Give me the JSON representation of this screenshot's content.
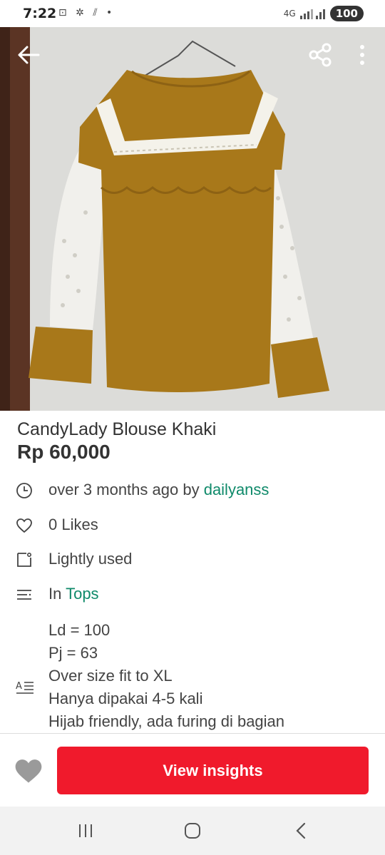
{
  "status_bar": {
    "time": "7:22",
    "icons": "⊡ ✲ ⫽ •",
    "network": "4G",
    "battery": "100"
  },
  "listing": {
    "title": "CandyLady Blouse Khaki",
    "price": "Rp 60,000",
    "posted_prefix": "over 3 months ago by",
    "seller": "dailyanss",
    "likes": "0 Likes",
    "condition": "Lightly used",
    "category_prefix": "In",
    "category": "Tops",
    "description_lines": [
      "Ld = 100",
      "Pj = 63",
      "Over size fit to XL",
      "Hanya dipakai 4-5 kali",
      "Hijab friendly, ada furing di bagian"
    ]
  },
  "actions": {
    "view_insights": "View insights"
  },
  "icons": {
    "back": "back-arrow-icon",
    "share": "share-icon",
    "more": "more-vert-icon",
    "time": "clock-icon",
    "likes": "heart-outline-icon",
    "condition": "tag-icon",
    "category": "list-icon",
    "description": "text-icon",
    "like_button": "heart-filled-icon"
  },
  "colors": {
    "accent_green": "#0f8a6a",
    "cta_red": "#f01a2c",
    "blouse_khaki": "#a8781a"
  }
}
